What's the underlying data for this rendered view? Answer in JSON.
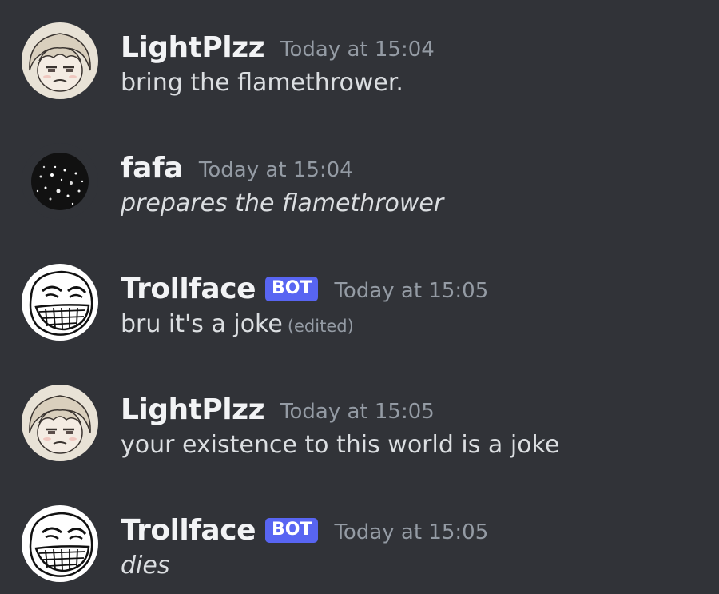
{
  "messages": [
    {
      "avatar_icon": "anime-boy-avatar-icon",
      "username": "LightPlzz",
      "is_bot": false,
      "timestamp": "Today at 15:04",
      "content": "bring the flamethrower.",
      "italic": false
    },
    {
      "avatar_icon": "dark-noise-avatar-icon",
      "username": "fafa",
      "is_bot": false,
      "timestamp": "Today at 15:04",
      "content": "prepares the flamethrower",
      "italic": true
    },
    {
      "avatar_icon": "trollface-avatar-icon",
      "username": "Trollface",
      "is_bot": true,
      "bot_tag": "BOT",
      "timestamp": "Today at 15:05",
      "content": "bru it's a joke",
      "edited_label": "(edited)",
      "italic": false
    },
    {
      "avatar_icon": "anime-boy-avatar-icon",
      "username": "LightPlzz",
      "is_bot": false,
      "timestamp": "Today at 15:05",
      "content": "your existence to this world is a joke",
      "italic": false
    },
    {
      "avatar_icon": "trollface-avatar-icon",
      "username": "Trollface",
      "is_bot": true,
      "bot_tag": "BOT",
      "timestamp": "Today at 15:05",
      "content": "dies",
      "italic": true
    }
  ],
  "colors": {
    "background": "#313338",
    "username": "#f2f3f5",
    "timestamp": "#949ba4",
    "message_text": "#dbdee1",
    "bot_tag_bg": "#5865f2"
  }
}
